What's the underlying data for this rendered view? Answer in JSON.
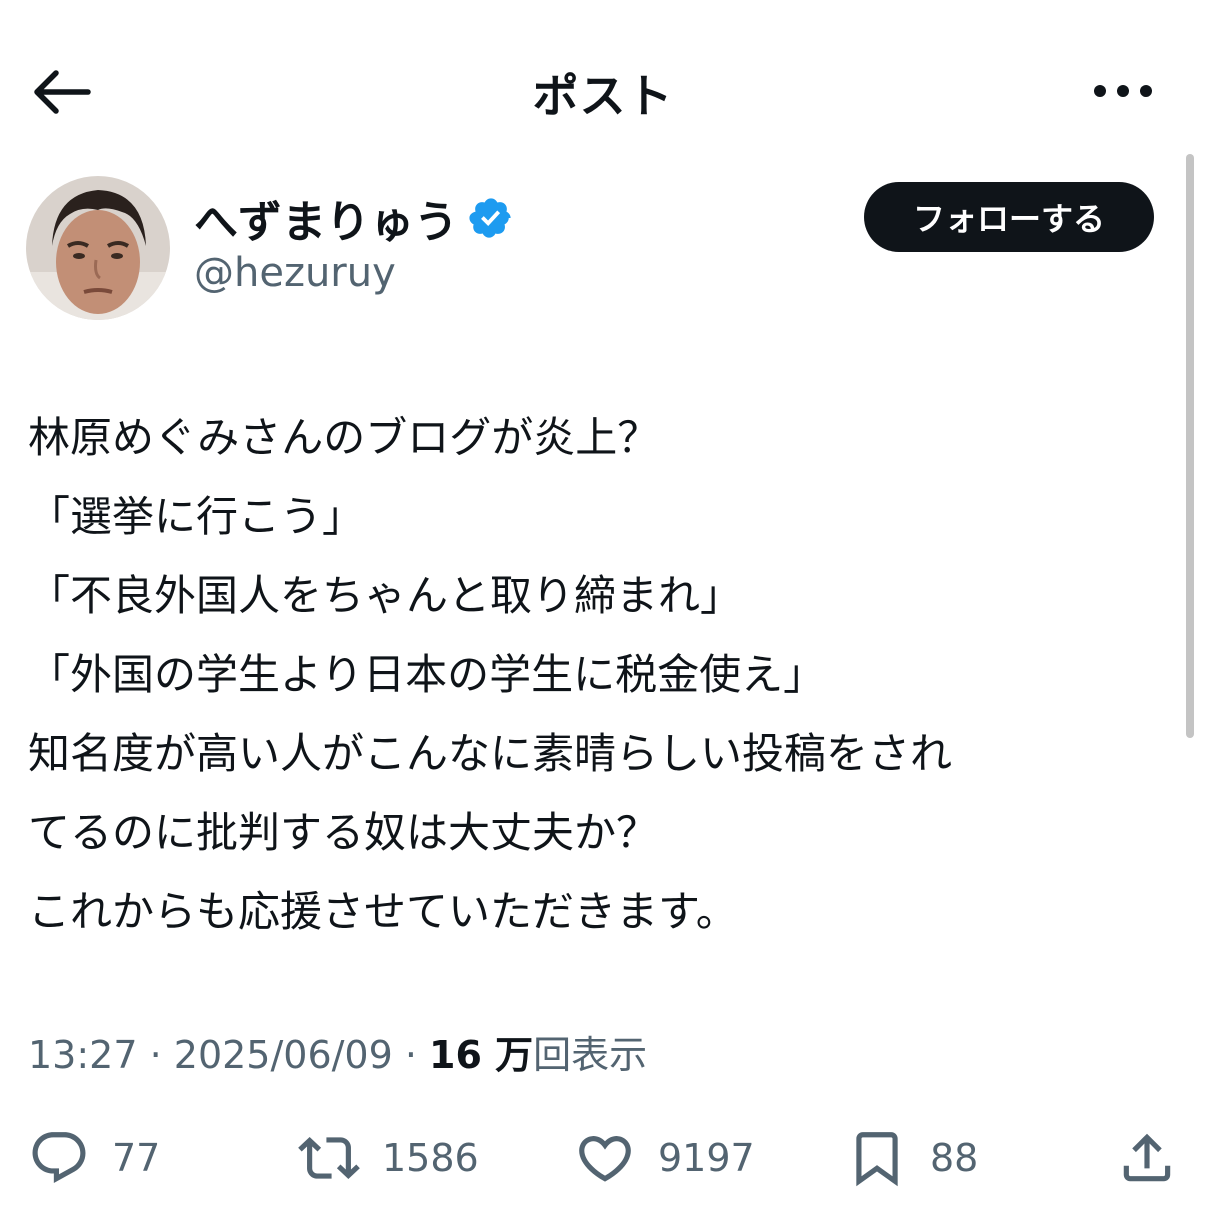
{
  "header": {
    "title": "ポスト"
  },
  "user": {
    "display_name": "へずまりゅう",
    "handle": "@hezuruy",
    "follow_label": "フォローする"
  },
  "post": {
    "lines": [
      "林原めぐみさんのブログが炎上？",
      "「選挙に行こう」",
      "「不良外国人をちゃんと取り締まれ」",
      "「外国の学生より日本の学生に税金使え」",
      "知名度が高い人がこんなに素晴らしい投稿をされ",
      "てるのに批判する奴は大丈夫か？",
      "これからも応援させていただきます。"
    ]
  },
  "meta": {
    "time": "13:27",
    "separator": " · ",
    "date": "2025/06/09",
    "views_count": "16 万",
    "views_label": "回表示"
  },
  "actions": {
    "replies": "77",
    "reposts": "1586",
    "likes": "9197",
    "bookmarks": "88"
  },
  "icons": {
    "back": "arrow-left-icon",
    "more": "more-horizontal-icon",
    "verified": "verified-badge-icon",
    "reply": "reply-icon",
    "repost": "repost-icon",
    "like": "heart-icon",
    "bookmark": "bookmark-icon",
    "share": "share-icon"
  },
  "colors": {
    "text": "#0f1419",
    "secondary_text": "#536471",
    "verified": "#1d9bf0",
    "follow_button_bg": "#0f1419"
  }
}
